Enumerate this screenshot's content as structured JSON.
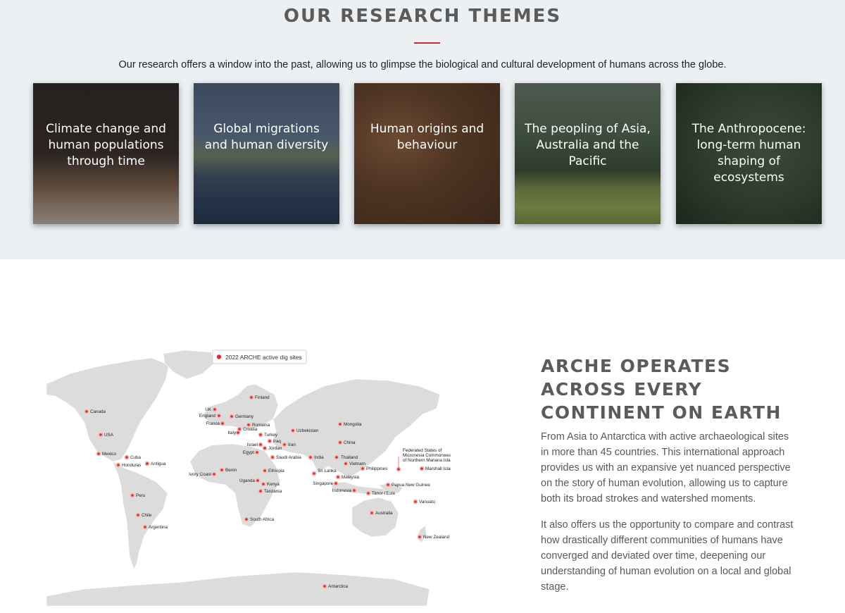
{
  "themes": {
    "title": "OUR RESEARCH THEMES",
    "intro": "Our research offers a window into the past, allowing us to glimpse the biological and cultural development of humans across the globe.",
    "cards": [
      {
        "label": "Climate change and human populations through time"
      },
      {
        "label": "Global migrations and human diversity"
      },
      {
        "label": "Human origins and behaviour"
      },
      {
        "label": "The peopling of Asia, Australia and the Pacific"
      },
      {
        "label": "The Anthropocene: long-term human shaping of ecosystems"
      }
    ]
  },
  "map": {
    "legend": "2022 ARCHE active dig sites",
    "marker_color": "#d9302f",
    "sites": [
      "Canada",
      "USA",
      "Mexico",
      "Cuba",
      "Honduras",
      "Antigua",
      "Peru",
      "Chile",
      "Argentina",
      "UK",
      "England",
      "France",
      "Germany",
      "Finland",
      "Croatia",
      "Romania",
      "Italy",
      "Turkey",
      "Iraq",
      "Israel",
      "Jordan",
      "Egypt",
      "Iran",
      "Saudi Arabia",
      "Uzbekistan",
      "Mongolia",
      "China",
      "India",
      "Sri Lanka",
      "Thailand",
      "Vietnam",
      "Philippines",
      "Malaysia",
      "Singapore",
      "Indonesia",
      "Timor-l'Este",
      "Papua New Guinea",
      "Federated States of",
      "Micronesia Commonwealth",
      "of Northern Mariana Islands",
      "Marshall Islands",
      "Vanuatu",
      "Australia",
      "New Zealand",
      "Ivory Coast",
      "Benin",
      "Ethiopia",
      "Uganda",
      "Kenya",
      "Tanzania",
      "South Africa",
      "Antarctica"
    ]
  },
  "operations": {
    "title": "ARCHE OPERATES ACROSS EVERY CONTINENT ON EARTH",
    "paragraph1": "From Asia to Antarctica with active archaeological sites in more than 45 countries. This international approach provides us with an expansive yet nuanced perspective on the story of human evolution, allowing us to capture both its broad strokes and watershed moments.",
    "paragraph2": "It also offers us the opportunity to compare and contrast how drastically different communities of humans have converged and deviated over time, deepening our understanding of human evolution on a local and global stage."
  }
}
